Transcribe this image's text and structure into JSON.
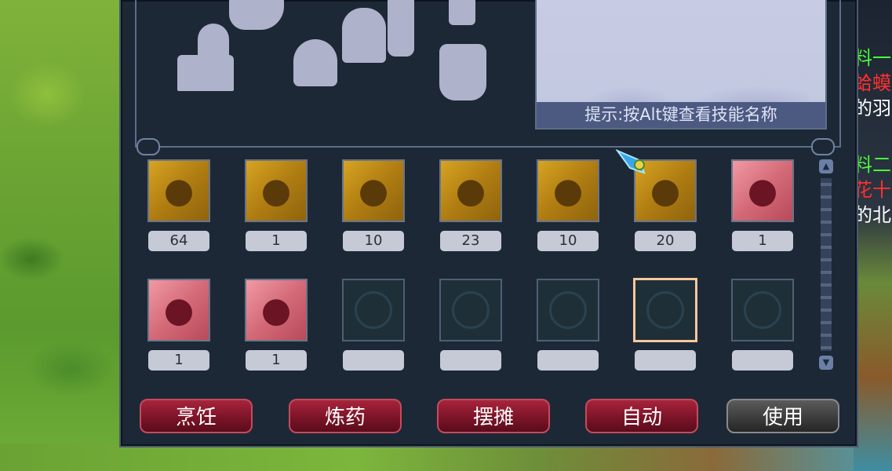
{
  "panel": {
    "hint": "提示:按Alt键查看技能名称"
  },
  "slots_row1": [
    {
      "type": "gold",
      "count": "64",
      "icon": "gold-item-icon"
    },
    {
      "type": "gold",
      "count": "1",
      "icon": "gold-item-icon"
    },
    {
      "type": "gold",
      "count": "10",
      "icon": "gold-item-icon"
    },
    {
      "type": "gold",
      "count": "23",
      "icon": "gold-item-icon"
    },
    {
      "type": "gold",
      "count": "10",
      "icon": "gold-item-icon"
    },
    {
      "type": "gold",
      "count": "20",
      "icon": "gold-item-icon"
    },
    {
      "type": "pink",
      "count": "1",
      "icon": "pink-item-icon"
    }
  ],
  "slots_row2": [
    {
      "type": "pink",
      "count": "1",
      "icon": "pink-item-icon"
    },
    {
      "type": "pink",
      "count": "1",
      "icon": "pink-item-icon"
    },
    {
      "type": "empty",
      "count": ""
    },
    {
      "type": "empty",
      "count": ""
    },
    {
      "type": "empty",
      "count": ""
    },
    {
      "type": "empty",
      "count": "",
      "selected": true
    },
    {
      "type": "empty",
      "count": ""
    }
  ],
  "buttons": {
    "cook": "烹饪",
    "alchemy": "炼药",
    "stall": "摆摊",
    "auto": "自动",
    "use": "使用"
  },
  "chat": [
    {
      "text": "料一",
      "color": "#4cff3a"
    },
    {
      "text": "蛤蟆",
      "color": "#ff3030"
    },
    {
      "text": "的羽",
      "color": "#ffffff"
    },
    {
      "text": "料二",
      "color": "#4cff3a"
    },
    {
      "text": "花十",
      "color": "#ff3030"
    },
    {
      "text": "的北",
      "color": "#ffffff"
    }
  ],
  "colors": {
    "panel_bg": "#1d2837",
    "hint_bg": "#c7cbe3",
    "button_red": "#7c1428",
    "button_dark": "#3a3a3a",
    "slot_gold": "#b07d12",
    "slot_pink": "#d46a78"
  }
}
